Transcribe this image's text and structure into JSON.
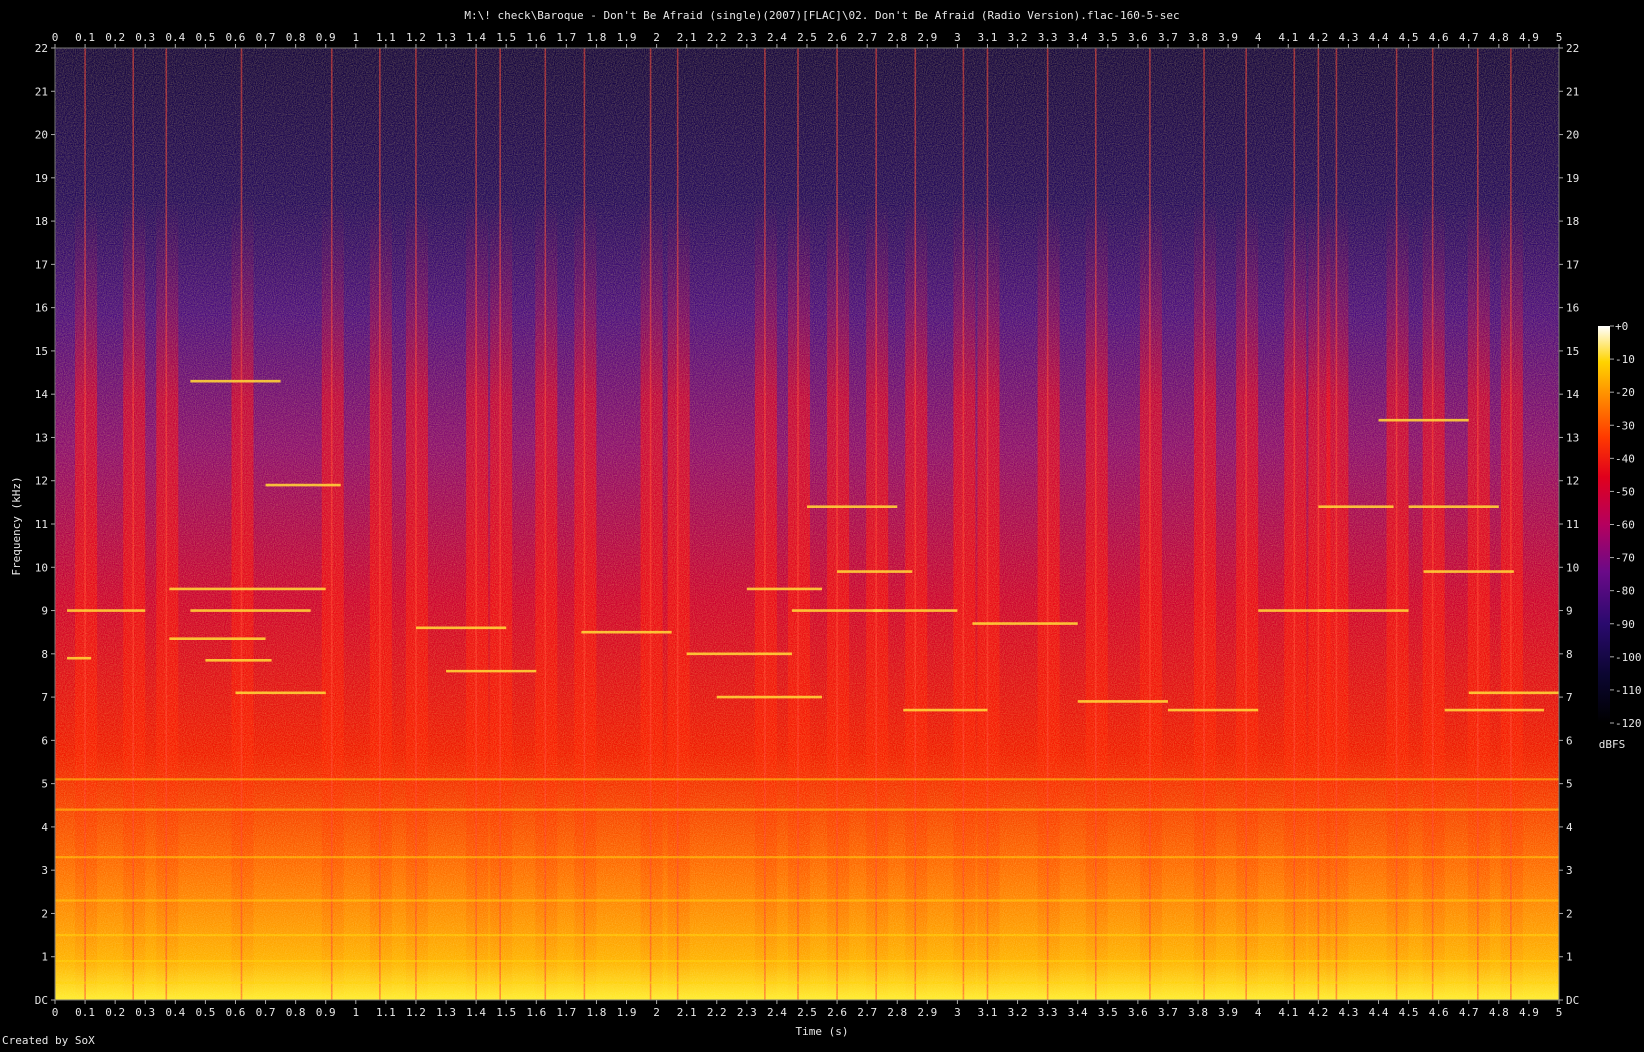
{
  "chart_data": {
    "type": "heatmap",
    "title": "M:\\! check\\Baroque - Don't Be Afraid (single)(2007)[FLAC]\\02. Don't Be Afraid (Radio Version).flac-160-5-sec",
    "xlabel": "Time (s)",
    "ylabel": "Frequency (kHz)",
    "xlim": [
      0,
      5
    ],
    "ylim": [
      0,
      22
    ],
    "x_ticks": [
      "0",
      "0.1",
      "0.2",
      "0.3",
      "0.4",
      "0.5",
      "0.6",
      "0.7",
      "0.8",
      "0.9",
      "1",
      "1.1",
      "1.2",
      "1.3",
      "1.4",
      "1.5",
      "1.6",
      "1.7",
      "1.8",
      "1.9",
      "2",
      "2.1",
      "2.2",
      "2.3",
      "2.4",
      "2.5",
      "2.6",
      "2.7",
      "2.8",
      "2.9",
      "3",
      "3.1",
      "3.2",
      "3.3",
      "3.4",
      "3.5",
      "3.6",
      "3.7",
      "3.8",
      "3.9",
      "4",
      "4.1",
      "4.2",
      "4.3",
      "4.4",
      "4.5",
      "4.6",
      "4.7",
      "4.8",
      "4.9",
      "5"
    ],
    "y_ticks": [
      "DC",
      "1",
      "2",
      "3",
      "4",
      "5",
      "6",
      "7",
      "8",
      "9",
      "10",
      "11",
      "12",
      "13",
      "14",
      "15",
      "16",
      "17",
      "18",
      "19",
      "20",
      "21",
      "22"
    ],
    "colorbar": {
      "label": "dBFS",
      "range": [
        -120,
        0
      ],
      "ticks": [
        "+0",
        "-10",
        "-20",
        "-30",
        "-40",
        "-50",
        "-60",
        "-70",
        "-80",
        "-90",
        "-100",
        "-110",
        "-120"
      ]
    },
    "transients_s": [
      0.1,
      0.26,
      0.37,
      0.62,
      0.92,
      1.08,
      1.2,
      1.4,
      1.48,
      1.63,
      1.76,
      1.98,
      2.07,
      2.36,
      2.47,
      2.6,
      2.73,
      2.86,
      3.02,
      3.1,
      3.3,
      3.46,
      3.64,
      3.82,
      3.96,
      4.12,
      4.2,
      4.26,
      4.46,
      4.58,
      4.73,
      4.84
    ],
    "tones": [
      {
        "t0": 0.04,
        "t1": 0.3,
        "f": 9.0
      },
      {
        "t0": 0.04,
        "t1": 0.12,
        "f": 7.9
      },
      {
        "t0": 0.38,
        "t1": 0.9,
        "f": 9.5
      },
      {
        "t0": 0.45,
        "t1": 0.85,
        "f": 9.0
      },
      {
        "t0": 0.38,
        "t1": 0.7,
        "f": 8.35
      },
      {
        "t0": 0.5,
        "t1": 0.72,
        "f": 7.85
      },
      {
        "t0": 0.6,
        "t1": 0.9,
        "f": 7.1
      },
      {
        "t0": 0.45,
        "t1": 0.75,
        "f": 14.3
      },
      {
        "t0": 0.7,
        "t1": 0.95,
        "f": 11.9
      },
      {
        "t0": 1.2,
        "t1": 1.5,
        "f": 8.6
      },
      {
        "t0": 1.3,
        "t1": 1.6,
        "f": 7.6
      },
      {
        "t0": 1.75,
        "t1": 2.05,
        "f": 8.5
      },
      {
        "t0": 2.1,
        "t1": 2.45,
        "f": 8.0
      },
      {
        "t0": 2.2,
        "t1": 2.55,
        "f": 7.0
      },
      {
        "t0": 2.3,
        "t1": 2.55,
        "f": 9.5
      },
      {
        "t0": 2.45,
        "t1": 2.75,
        "f": 9.0
      },
      {
        "t0": 2.5,
        "t1": 2.8,
        "f": 11.4
      },
      {
        "t0": 2.6,
        "t1": 2.85,
        "f": 9.9
      },
      {
        "t0": 2.72,
        "t1": 3.0,
        "f": 9.0
      },
      {
        "t0": 2.82,
        "t1": 3.1,
        "f": 6.7
      },
      {
        "t0": 3.05,
        "t1": 3.4,
        "f": 8.7
      },
      {
        "t0": 3.4,
        "t1": 3.7,
        "f": 6.9
      },
      {
        "t0": 3.7,
        "t1": 4.0,
        "f": 6.7
      },
      {
        "t0": 4.0,
        "t1": 4.25,
        "f": 9.0
      },
      {
        "t0": 4.2,
        "t1": 4.5,
        "f": 9.0
      },
      {
        "t0": 4.2,
        "t1": 4.45,
        "f": 11.4
      },
      {
        "t0": 4.4,
        "t1": 4.7,
        "f": 13.4
      },
      {
        "t0": 4.5,
        "t1": 4.8,
        "f": 11.4
      },
      {
        "t0": 4.55,
        "t1": 4.85,
        "f": 9.9
      },
      {
        "t0": 4.62,
        "t1": 4.95,
        "f": 6.7
      },
      {
        "t0": 4.7,
        "t1": 5.0,
        "f": 7.1
      },
      {
        "t0": 0.0,
        "t1": 5.0,
        "f": 0.4
      },
      {
        "t0": 0.0,
        "t1": 5.0,
        "f": 0.9
      },
      {
        "t0": 0.0,
        "t1": 5.0,
        "f": 1.5
      },
      {
        "t0": 0.0,
        "t1": 5.0,
        "f": 2.3
      },
      {
        "t0": 0.0,
        "t1": 5.0,
        "f": 3.3
      },
      {
        "t0": 0.0,
        "t1": 5.0,
        "f": 4.4
      },
      {
        "t0": 0.0,
        "t1": 5.0,
        "f": 5.1
      }
    ],
    "grid": false,
    "legend": "right"
  },
  "footer": "Created by SoX"
}
